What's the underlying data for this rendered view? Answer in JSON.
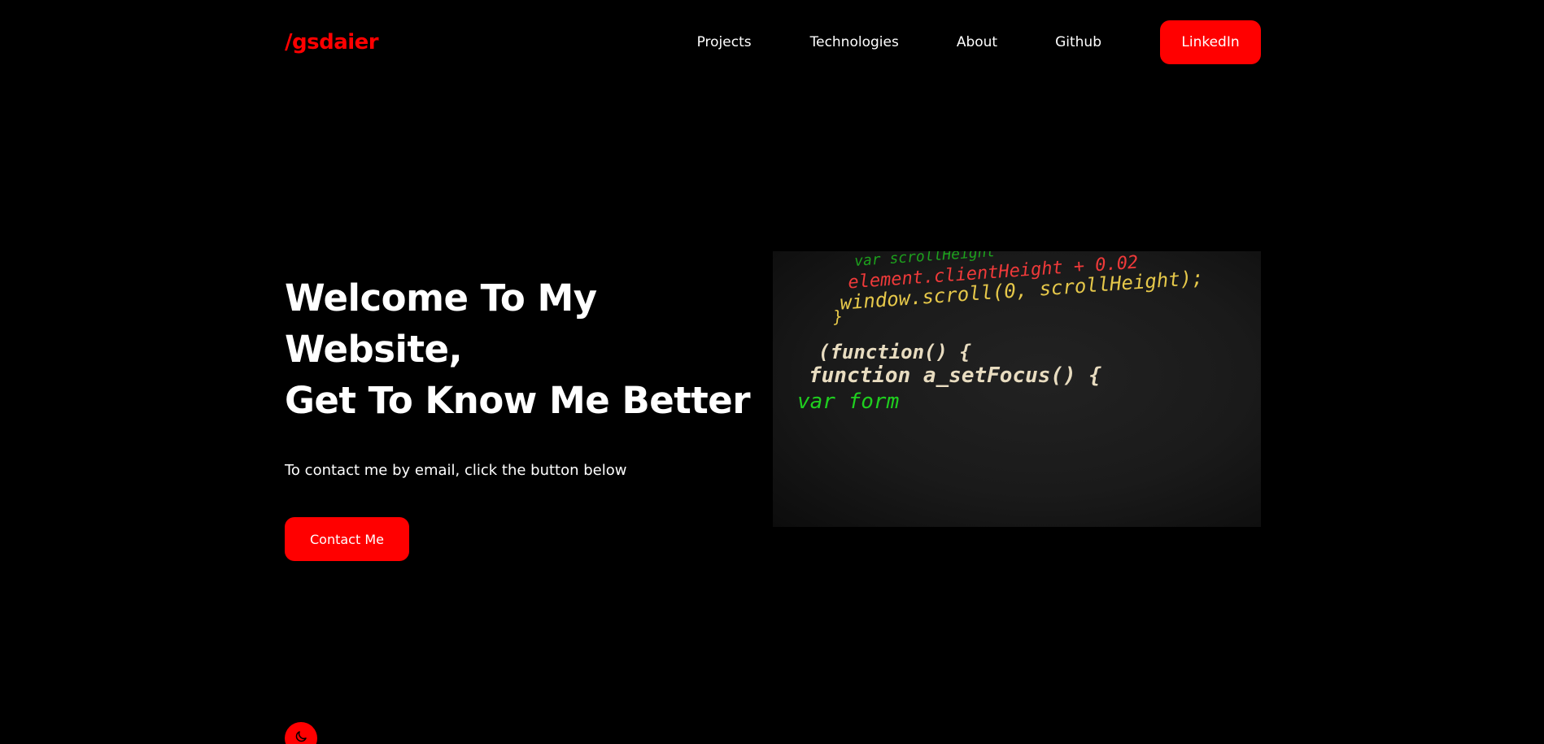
{
  "header": {
    "logo": "/gsdaier",
    "nav_links": [
      "Projects",
      "Technologies",
      "About",
      "Github"
    ],
    "cta_label": "LinkedIn"
  },
  "hero": {
    "title_line1": "Welcome To My Website,",
    "title_line2": "Get To Know Me Better",
    "subtitle": "To contact me by email, click the button below",
    "button_label": "Contact Me"
  },
  "code_image": {
    "lines": [
      "var scrollHeight",
      "element.clientHeight + 0.02",
      "window.scroll(0, scrollHeight);",
      "}",
      "(function() {",
      "function a_setFocus() {",
      "var form"
    ]
  },
  "theme_toggle": {
    "icon": "moon-icon"
  },
  "colors": {
    "accent": "#ff0000",
    "background": "#000000",
    "text": "#ffffff"
  }
}
